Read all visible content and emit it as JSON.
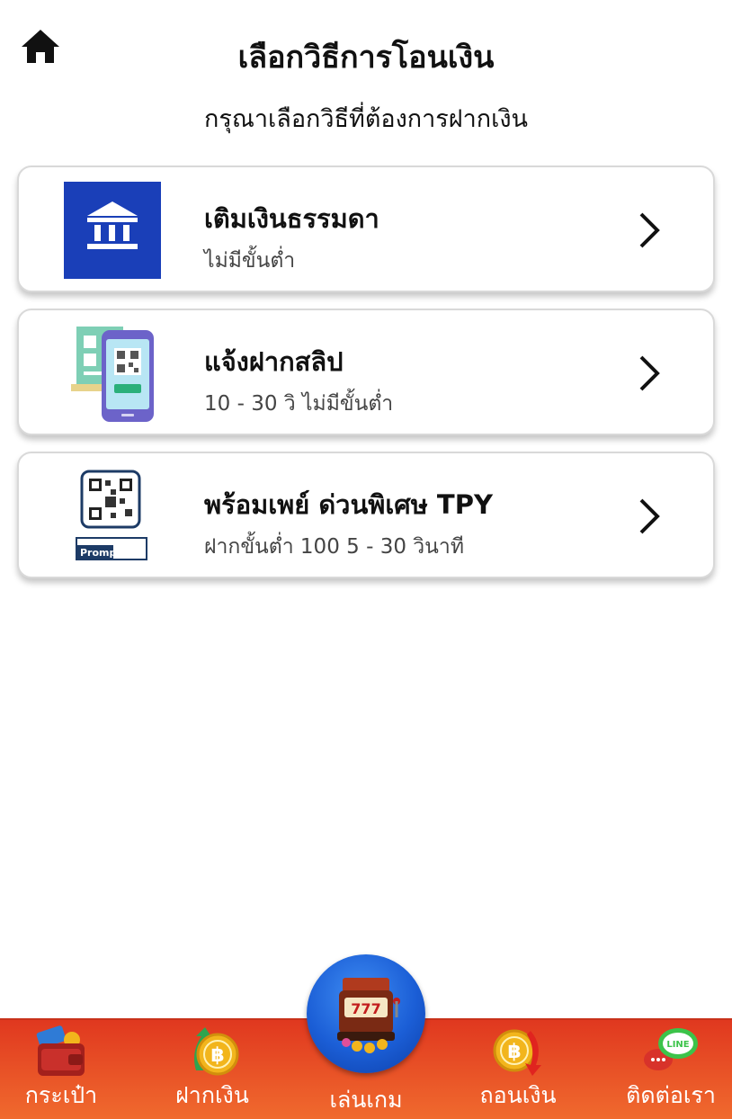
{
  "header": {
    "title": "เลือกวิธีการโอนเงิน",
    "subtitle": "กรุณาเลือกวิธีที่ต้องการฝากเงิน",
    "home_icon": "home-icon"
  },
  "options": [
    {
      "title": "เติมเงินธรรมดา",
      "subtitle": "ไม่มีขั้นต่ำ",
      "icon": "bank-icon"
    },
    {
      "title": "แจ้งฝากสลิป",
      "subtitle": "10 - 30 วิ ไม่มีขั้นต่ำ",
      "icon": "qr-slip-icon"
    },
    {
      "title": "พร้อมเพย์ ด่วนพิเศษ TPY",
      "subtitle": "ฝากขั้นต่ำ 100 5 - 30 วินาที",
      "icon": "promptpay-qr-icon",
      "logo_text": "PromptPay"
    }
  ],
  "bottom_nav": {
    "items": [
      {
        "label": "กระเป๋า",
        "icon": "wallet-icon"
      },
      {
        "label": "ฝากเงิน",
        "icon": "deposit-coin-icon"
      },
      {
        "label": "เล่นเกม",
        "icon": "slot-machine-icon"
      },
      {
        "label": "ถอนเงิน",
        "icon": "withdraw-coin-icon"
      },
      {
        "label": "ติดต่อเรา",
        "icon": "line-chat-icon"
      }
    ]
  },
  "colors": {
    "bank_bg": "#1a3fb8",
    "nav_bg_top": "#e0381f",
    "nav_bg_bottom": "#f06a2e",
    "play_button": "#1b5ed6",
    "coin_gold": "#f2b51c"
  }
}
